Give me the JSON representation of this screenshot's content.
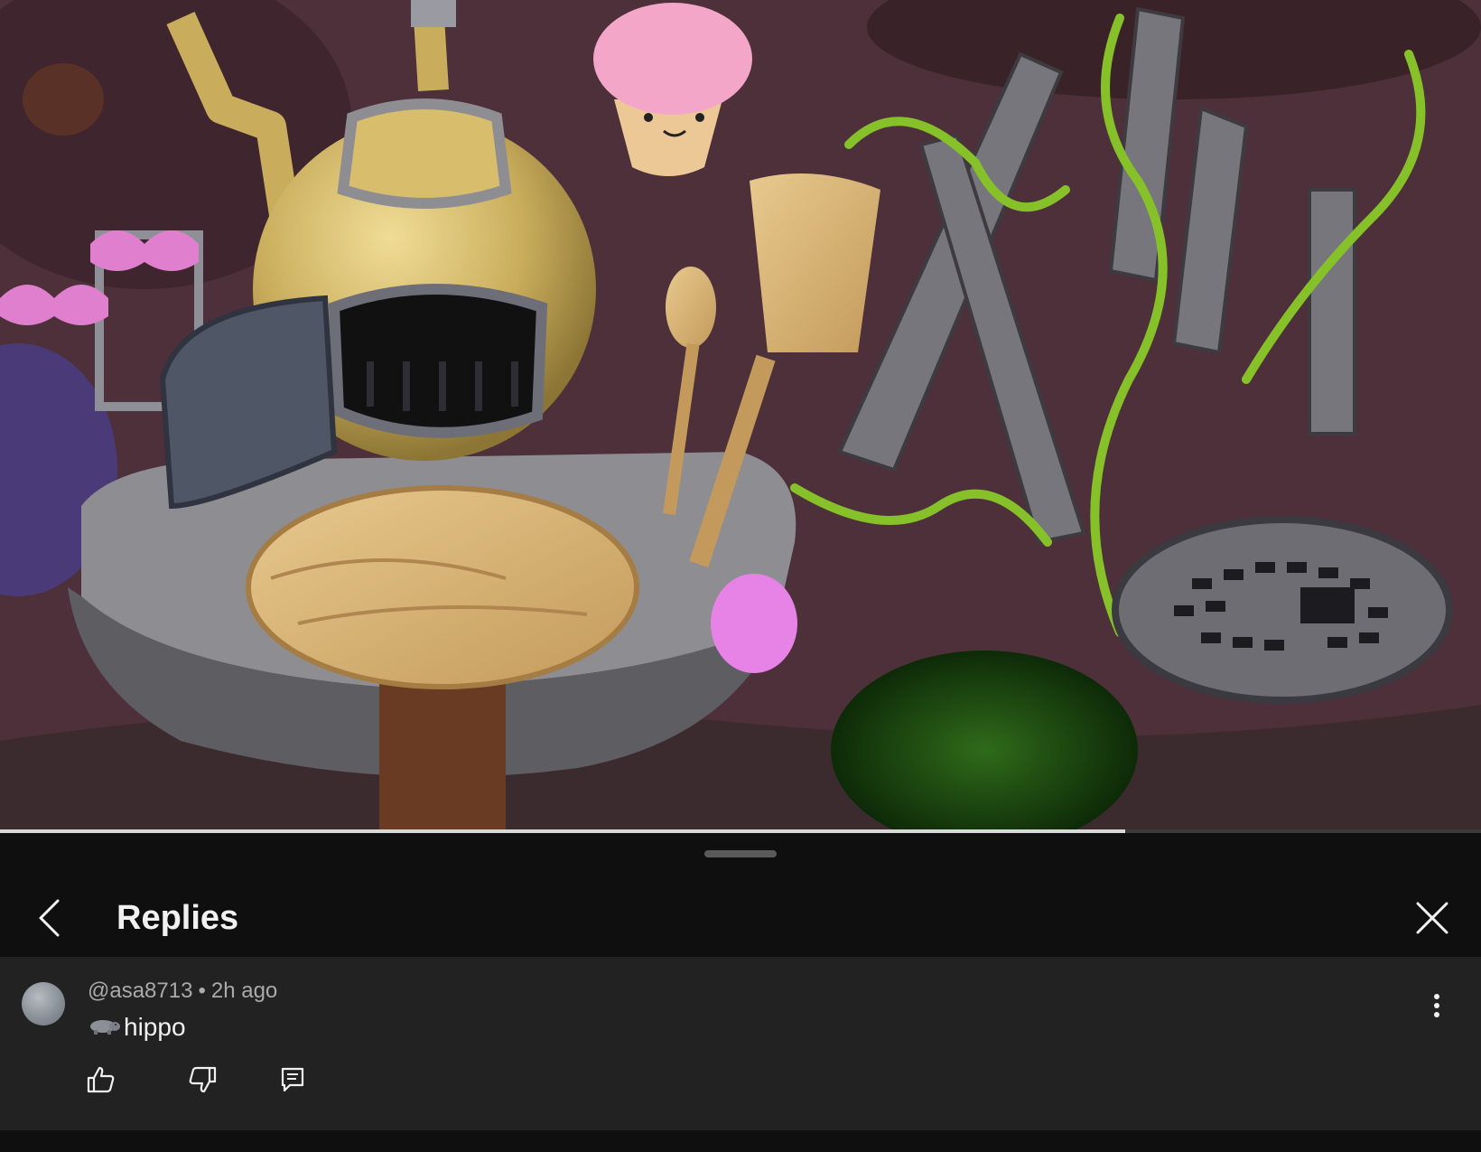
{
  "video": {
    "progress": 0.76,
    "colors": {
      "background": "#4d3039",
      "progress_fill": "#d9d9d9"
    }
  },
  "sheet": {
    "title": "Replies",
    "back_icon": "chevron-left-icon",
    "close_icon": "close-icon"
  },
  "comment": {
    "author": "@asa8713",
    "separator": "•",
    "time": "2h ago",
    "emoji": "hippo-emoji",
    "text": "hippo",
    "more_icon": "more-vert-icon",
    "actions": {
      "like_icon": "thumb-up-icon",
      "dislike_icon": "thumb-down-icon",
      "reply_icon": "reply-icon"
    }
  },
  "colors": {
    "sheet_bg": "#0f0f0f",
    "comment_bg": "#222222",
    "text_primary": "#f1f1f1",
    "text_secondary": "#aaaaaa"
  }
}
